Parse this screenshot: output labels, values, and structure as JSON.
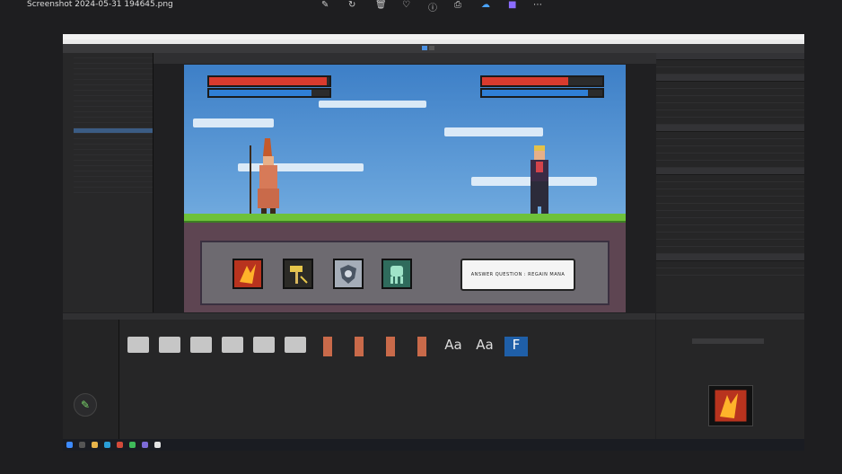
{
  "viewer": {
    "title": "Screenshot 2024-05-31 194645.png",
    "icons": [
      "edit-icon",
      "rotate-icon",
      "delete-icon",
      "heart-icon",
      "info-icon",
      "print-icon",
      "cloud-icon",
      "app-icon",
      "more-icon"
    ]
  },
  "game": {
    "answer_button": "ANSWER QUESTION : REGAIN MANA",
    "player_hp": 0.98,
    "player_mana": 0.85,
    "enemy_hp": 0.72,
    "enemy_mana": 0.88
  },
  "abilities": [
    "fire-ability-icon",
    "hammer-ability-icon",
    "shield-ability-icon",
    "spirit-ability-icon"
  ],
  "assets": [
    {
      "type": "folder"
    },
    {
      "type": "folder"
    },
    {
      "type": "folder"
    },
    {
      "type": "folder"
    },
    {
      "type": "folder"
    },
    {
      "type": "folder"
    },
    {
      "type": "sprite"
    },
    {
      "type": "sprite"
    },
    {
      "type": "sprite"
    },
    {
      "type": "sprite"
    },
    {
      "type": "font",
      "glyph": "Aa"
    },
    {
      "type": "font",
      "glyph": "Aa"
    },
    {
      "type": "font",
      "glyph": "F"
    }
  ],
  "colors": {
    "hp": "#d93b2e",
    "mana": "#2f7fd6",
    "accent": "#3b5c84"
  }
}
